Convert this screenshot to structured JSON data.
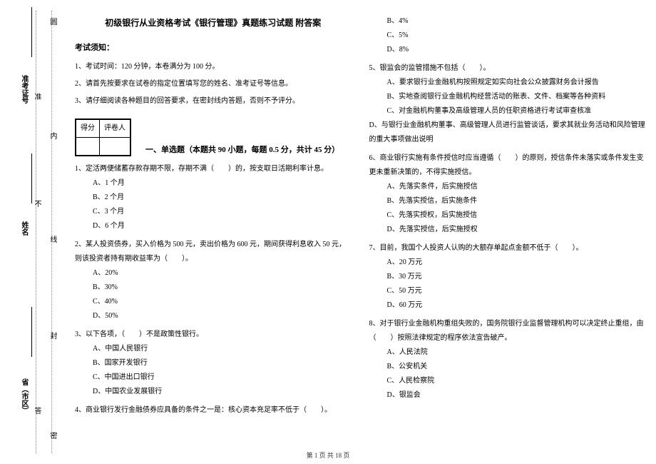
{
  "sidebar": {
    "seals": [
      "密",
      "封",
      "线",
      "内",
      "圆"
    ],
    "fields": {
      "province": "省（市区）",
      "name": "姓名",
      "ticket": "准考证号",
      "prep": "准",
      "not": "不",
      "answer": "答"
    }
  },
  "doc": {
    "title": "初级银行从业资格考试《银行管理》真题练习试题 附答案",
    "notice_header": "考试须知：",
    "notices": [
      "1、考试时间：120 分钟，本卷满分为 100 分。",
      "2、请首先按要求在试卷的指定位置填写您的姓名、准考证号等信息。",
      "3、请仔细阅读各种题目的回答要求，在密封线内答题，否则不予评分。"
    ],
    "score_labels": {
      "score": "得分",
      "reviewer": "评卷人"
    },
    "section1": "一、单选题（本题共 90 小题，每题 0.5 分，共计 45 分）",
    "q1": {
      "stem": "1、定活两便储蓄存款存期不限，存期不满（　　）的，按支取日活期利率计息。",
      "a": "A、1 个月",
      "b": "B、2 个月",
      "c": "C、3 个月",
      "d": "D、6 个月"
    },
    "q2": {
      "stem": "2、某人投资债券，买入价格为 500 元，卖出价格为 600 元，期间获得利息收入 50 元，则该投资者持有期收益率为（　　）。",
      "a": "A、20%",
      "b": "B、30%",
      "c": "C、40%",
      "d": "D、50%"
    },
    "q3": {
      "stem": "3、以下各项，（　　）不是政策性银行。",
      "a": "A、中国人民银行",
      "b": "B、国家开发银行",
      "c": "C、中国进出口银行",
      "d": "D、中国农业发展银行"
    },
    "q4": {
      "stem": "4、商业银行发行金融债券应具备的条件之一是：核心资本充足率不低于（　　）。",
      "b": "B、4%",
      "c": "C、5%",
      "d": "D、8%"
    },
    "q5": {
      "stem": "5、银监会的监管措施不包括（　　）。",
      "a": "A、要求银行业金融机构按照规定如实向社会公众披露财务会计报告",
      "b": "B、实地查阅银行业金融机构经营活动的账表、文件、档案等各种资料",
      "c": "C、对金融机构董事及高级管理人员的任职资格进行考试审查核准",
      "d": "D、与银行业金融机构董事、高级管理人员进行监管谈话，要求其就业务活动和风险管理的重大事项做出说明"
    },
    "q6": {
      "stem": "6、商业银行实施有条件授信时应当遵循（　　）的原则，授信条件未落实或条件发生变更未重新决策的，不得实施授信。",
      "a": "A、先落实条件，后实施授信",
      "b": "B、先落实授信，后实施条件",
      "c": "C、先落实授权，后实施授信",
      "d": "D、先落实授信，后实施授权"
    },
    "q7": {
      "stem": "7、目前，我国个人投资人认购的大额存单起点金额不低于（　　）。",
      "a": "A、20 万元",
      "b": "B、30 万元",
      "c": "C、50 万元",
      "d": "D、60 万元"
    },
    "q8": {
      "stem": "8、对于银行业金融机构重组失败的，国务院银行业监督管理机构可以决定终止重组，由（　　）按照法律规定的程序依法宣告破产。",
      "a": "A、人民法院",
      "b": "B、公安机关",
      "c": "C、人民检察院",
      "d": "D、银监会"
    }
  },
  "footer": "第 1 页 共 18 页"
}
